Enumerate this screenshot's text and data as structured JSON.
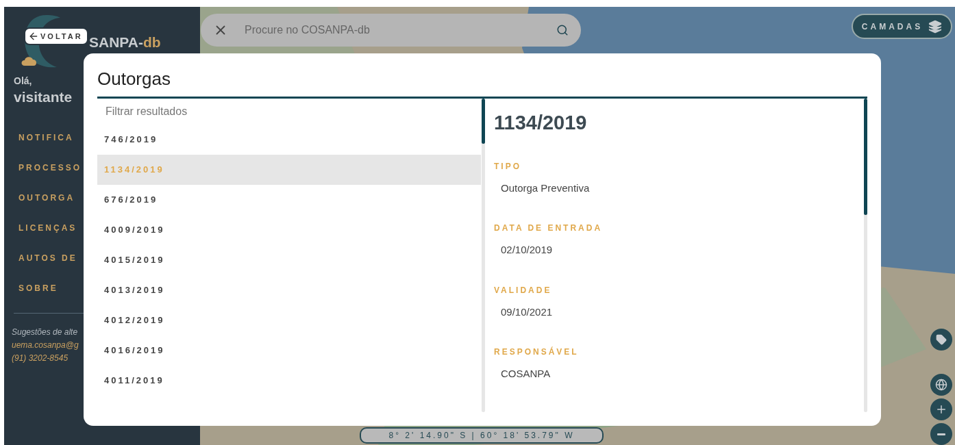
{
  "header": {
    "back_button": "VOLTAR",
    "logo": {
      "text": "SANPA-",
      "accent": "db"
    }
  },
  "search": {
    "placeholder": "Procure no COSANPA-db"
  },
  "layers_button": "CAMADAS",
  "sidebar": {
    "greeting": "Olá,",
    "user": "visitante",
    "items": [
      "NOTIFICA",
      "PROCESSO",
      "OUTORGA",
      "LICENÇAS",
      "AUTOS DE",
      "SOBRE"
    ],
    "footer": [
      "Sugestões de alte",
      "uema.cosanpa@g",
      "(91) 3202-8545"
    ]
  },
  "dialog": {
    "title": "Outorgas",
    "filter": {
      "placeholder": "Filtrar resultados"
    },
    "items": [
      {
        "label": "746/2019",
        "selected": false
      },
      {
        "label": "1134/2019",
        "selected": true
      },
      {
        "label": "676/2019",
        "selected": false
      },
      {
        "label": "4009/2019",
        "selected": false
      },
      {
        "label": "4015/2019",
        "selected": false
      },
      {
        "label": "4013/2019",
        "selected": false
      },
      {
        "label": "4012/2019",
        "selected": false
      },
      {
        "label": "4016/2019",
        "selected": false
      },
      {
        "label": "4011/2019",
        "selected": false
      }
    ],
    "detail": {
      "title": "1134/2019",
      "fields": [
        {
          "label": "TIPO",
          "value": "Outorga Preventiva"
        },
        {
          "label": "DATA DE ENTRADA",
          "value": "02/10/2019"
        },
        {
          "label": "VALIDADE",
          "value": "09/10/2021"
        },
        {
          "label": "RESPONSÁVEL",
          "value": "COSANPA"
        }
      ]
    }
  },
  "coordinates": "8° 2' 14.90\" S | 60° 18' 53.79\" W"
}
